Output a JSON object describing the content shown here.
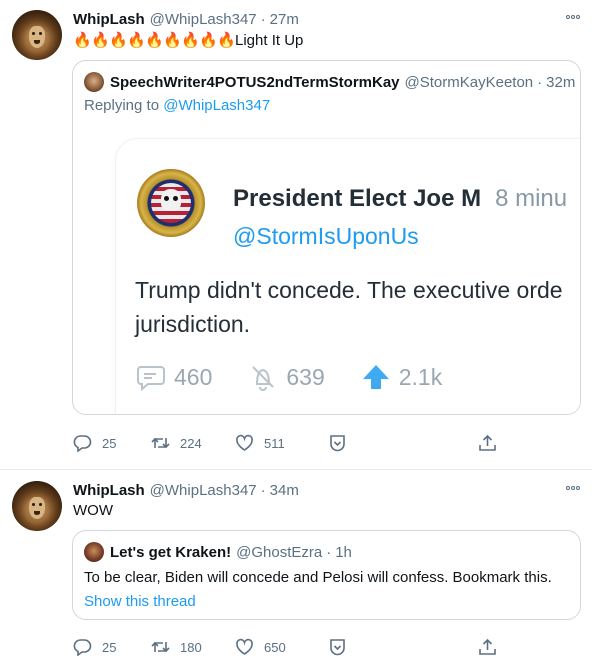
{
  "tweets": [
    {
      "author_name": "WhipLash",
      "handle": "@WhipLash347",
      "time": "27m",
      "fire_icons": [
        "🔥",
        "🔥",
        "🔥",
        "🔥",
        "🔥",
        "🔥",
        "🔥",
        "🔥",
        "🔥"
      ],
      "text": "Light It Up",
      "quote": {
        "author_name": "SpeechWriter4POTUS2ndTermStormKay",
        "handle": "@StormKayKeeton",
        "time": "32m",
        "replying_prefix": "Replying to ",
        "replying_to": "@WhipLash347",
        "embedded": {
          "author_name": "President Elect Joe M",
          "time": "8 minu",
          "handle": "@StormIsUponUs",
          "text_line1": "Trump didn't concede. The executive orde",
          "text_line2": "jurisdiction.",
          "replies": "460",
          "retweets": "639",
          "likes": "2.1k"
        }
      },
      "actions": {
        "replies": "25",
        "retweets": "224",
        "likes": "511"
      }
    },
    {
      "author_name": "WhipLash",
      "handle": "@WhipLash347",
      "time": "34m",
      "text": "WOW",
      "quote": {
        "author_name": "Let's get Kraken!",
        "handle": "@GhostEzra",
        "time": "1h",
        "text": "To be clear, Biden will concede and Pelosi will confess. Bookmark this.",
        "show_thread": "Show this thread"
      },
      "actions": {
        "replies": "25",
        "retweets": "180",
        "likes": "650"
      }
    }
  ],
  "separator": "·",
  "colors": {
    "link": "#1d9bf0",
    "secondary": "#5b7083",
    "border": "#cfd9de"
  }
}
